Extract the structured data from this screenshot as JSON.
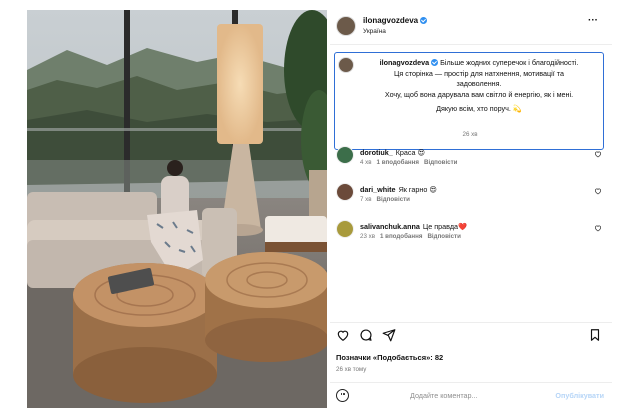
{
  "post": {
    "username": "ilonagvozdeva",
    "location": "Україна",
    "more_icon": "more-horizontal-icon"
  },
  "caption": {
    "username": "ilonagvozdeva",
    "line1": "Більше жодних суперечок і благодійності.",
    "line2": "Ця сторінка — простір для натхнення, мотивації та",
    "line3": "задоволення.",
    "line4": "Хочу, щоб вона дарувала вам світло й енергію, як і мені.",
    "line5": "Дякую всім, хто поруч. 💫",
    "time": "26 хв"
  },
  "comments": [
    {
      "username": "dorotiuk_",
      "text": "Краса 😍",
      "time": "4 хв",
      "likes": "1 вподобання",
      "reply": "Відповісти",
      "avatar_color": "#3c6e4a"
    },
    {
      "username": "dari_white",
      "text": "Як гарно 😍",
      "time": "7 хв",
      "reply": "Відповісти",
      "avatar_color": "#6b4a3a"
    },
    {
      "username": "salivanchuk.anna",
      "text": "Це правда❤️",
      "time": "23 хв",
      "likes": "1 вподобання",
      "reply": "Відповісти",
      "avatar_color": "#a89a3c"
    }
  ],
  "actions": {
    "likes_text": "Позначки «Подобається»: 82",
    "time_ago": "26 хв тому"
  },
  "comment_box": {
    "placeholder": "Додайте коментар...",
    "publish_label": "Опублікувати"
  },
  "colors": {
    "verified": "#2f8ff0",
    "caption_border": "#2f6fd6",
    "publish_disabled": "#b6d5f7"
  }
}
